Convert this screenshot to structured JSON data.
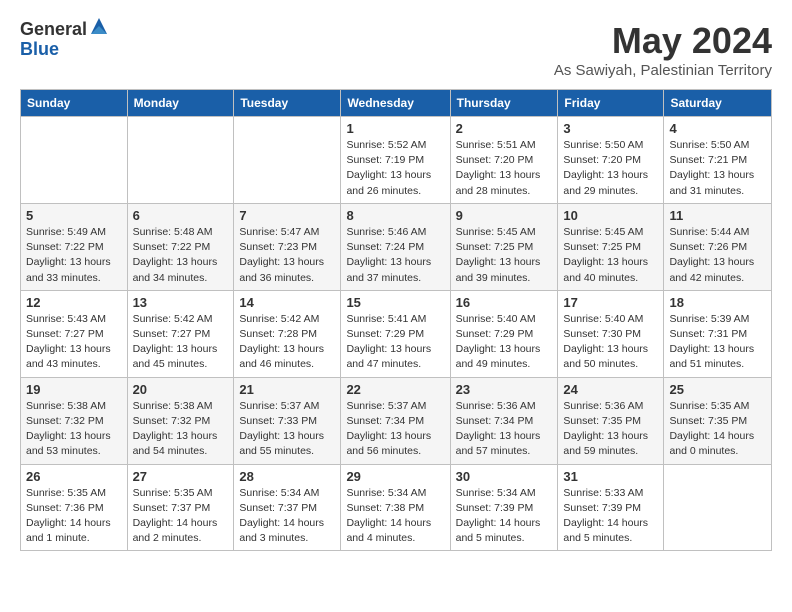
{
  "header": {
    "logo": {
      "general": "General",
      "blue": "Blue"
    },
    "title": "May 2024",
    "location": "As Sawiyah, Palestinian Territory"
  },
  "weekdays": [
    "Sunday",
    "Monday",
    "Tuesday",
    "Wednesday",
    "Thursday",
    "Friday",
    "Saturday"
  ],
  "weeks": [
    [
      null,
      null,
      null,
      {
        "day": "1",
        "sunrise": "Sunrise: 5:52 AM",
        "sunset": "Sunset: 7:19 PM",
        "daylight": "Daylight: 13 hours and 26 minutes."
      },
      {
        "day": "2",
        "sunrise": "Sunrise: 5:51 AM",
        "sunset": "Sunset: 7:20 PM",
        "daylight": "Daylight: 13 hours and 28 minutes."
      },
      {
        "day": "3",
        "sunrise": "Sunrise: 5:50 AM",
        "sunset": "Sunset: 7:20 PM",
        "daylight": "Daylight: 13 hours and 29 minutes."
      },
      {
        "day": "4",
        "sunrise": "Sunrise: 5:50 AM",
        "sunset": "Sunset: 7:21 PM",
        "daylight": "Daylight: 13 hours and 31 minutes."
      }
    ],
    [
      {
        "day": "5",
        "sunrise": "Sunrise: 5:49 AM",
        "sunset": "Sunset: 7:22 PM",
        "daylight": "Daylight: 13 hours and 33 minutes."
      },
      {
        "day": "6",
        "sunrise": "Sunrise: 5:48 AM",
        "sunset": "Sunset: 7:22 PM",
        "daylight": "Daylight: 13 hours and 34 minutes."
      },
      {
        "day": "7",
        "sunrise": "Sunrise: 5:47 AM",
        "sunset": "Sunset: 7:23 PM",
        "daylight": "Daylight: 13 hours and 36 minutes."
      },
      {
        "day": "8",
        "sunrise": "Sunrise: 5:46 AM",
        "sunset": "Sunset: 7:24 PM",
        "daylight": "Daylight: 13 hours and 37 minutes."
      },
      {
        "day": "9",
        "sunrise": "Sunrise: 5:45 AM",
        "sunset": "Sunset: 7:25 PM",
        "daylight": "Daylight: 13 hours and 39 minutes."
      },
      {
        "day": "10",
        "sunrise": "Sunrise: 5:45 AM",
        "sunset": "Sunset: 7:25 PM",
        "daylight": "Daylight: 13 hours and 40 minutes."
      },
      {
        "day": "11",
        "sunrise": "Sunrise: 5:44 AM",
        "sunset": "Sunset: 7:26 PM",
        "daylight": "Daylight: 13 hours and 42 minutes."
      }
    ],
    [
      {
        "day": "12",
        "sunrise": "Sunrise: 5:43 AM",
        "sunset": "Sunset: 7:27 PM",
        "daylight": "Daylight: 13 hours and 43 minutes."
      },
      {
        "day": "13",
        "sunrise": "Sunrise: 5:42 AM",
        "sunset": "Sunset: 7:27 PM",
        "daylight": "Daylight: 13 hours and 45 minutes."
      },
      {
        "day": "14",
        "sunrise": "Sunrise: 5:42 AM",
        "sunset": "Sunset: 7:28 PM",
        "daylight": "Daylight: 13 hours and 46 minutes."
      },
      {
        "day": "15",
        "sunrise": "Sunrise: 5:41 AM",
        "sunset": "Sunset: 7:29 PM",
        "daylight": "Daylight: 13 hours and 47 minutes."
      },
      {
        "day": "16",
        "sunrise": "Sunrise: 5:40 AM",
        "sunset": "Sunset: 7:29 PM",
        "daylight": "Daylight: 13 hours and 49 minutes."
      },
      {
        "day": "17",
        "sunrise": "Sunrise: 5:40 AM",
        "sunset": "Sunset: 7:30 PM",
        "daylight": "Daylight: 13 hours and 50 minutes."
      },
      {
        "day": "18",
        "sunrise": "Sunrise: 5:39 AM",
        "sunset": "Sunset: 7:31 PM",
        "daylight": "Daylight: 13 hours and 51 minutes."
      }
    ],
    [
      {
        "day": "19",
        "sunrise": "Sunrise: 5:38 AM",
        "sunset": "Sunset: 7:32 PM",
        "daylight": "Daylight: 13 hours and 53 minutes."
      },
      {
        "day": "20",
        "sunrise": "Sunrise: 5:38 AM",
        "sunset": "Sunset: 7:32 PM",
        "daylight": "Daylight: 13 hours and 54 minutes."
      },
      {
        "day": "21",
        "sunrise": "Sunrise: 5:37 AM",
        "sunset": "Sunset: 7:33 PM",
        "daylight": "Daylight: 13 hours and 55 minutes."
      },
      {
        "day": "22",
        "sunrise": "Sunrise: 5:37 AM",
        "sunset": "Sunset: 7:34 PM",
        "daylight": "Daylight: 13 hours and 56 minutes."
      },
      {
        "day": "23",
        "sunrise": "Sunrise: 5:36 AM",
        "sunset": "Sunset: 7:34 PM",
        "daylight": "Daylight: 13 hours and 57 minutes."
      },
      {
        "day": "24",
        "sunrise": "Sunrise: 5:36 AM",
        "sunset": "Sunset: 7:35 PM",
        "daylight": "Daylight: 13 hours and 59 minutes."
      },
      {
        "day": "25",
        "sunrise": "Sunrise: 5:35 AM",
        "sunset": "Sunset: 7:35 PM",
        "daylight": "Daylight: 14 hours and 0 minutes."
      }
    ],
    [
      {
        "day": "26",
        "sunrise": "Sunrise: 5:35 AM",
        "sunset": "Sunset: 7:36 PM",
        "daylight": "Daylight: 14 hours and 1 minute."
      },
      {
        "day": "27",
        "sunrise": "Sunrise: 5:35 AM",
        "sunset": "Sunset: 7:37 PM",
        "daylight": "Daylight: 14 hours and 2 minutes."
      },
      {
        "day": "28",
        "sunrise": "Sunrise: 5:34 AM",
        "sunset": "Sunset: 7:37 PM",
        "daylight": "Daylight: 14 hours and 3 minutes."
      },
      {
        "day": "29",
        "sunrise": "Sunrise: 5:34 AM",
        "sunset": "Sunset: 7:38 PM",
        "daylight": "Daylight: 14 hours and 4 minutes."
      },
      {
        "day": "30",
        "sunrise": "Sunrise: 5:34 AM",
        "sunset": "Sunset: 7:39 PM",
        "daylight": "Daylight: 14 hours and 5 minutes."
      },
      {
        "day": "31",
        "sunrise": "Sunrise: 5:33 AM",
        "sunset": "Sunset: 7:39 PM",
        "daylight": "Daylight: 14 hours and 5 minutes."
      },
      null
    ]
  ]
}
